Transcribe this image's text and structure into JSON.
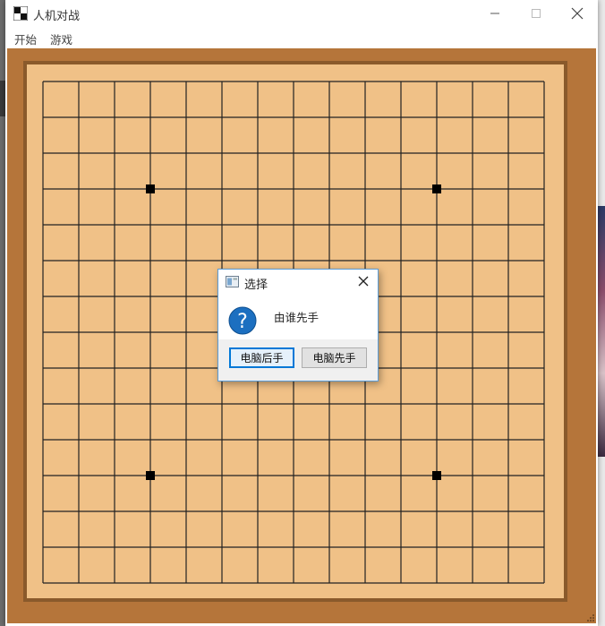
{
  "window": {
    "title": "人机对战",
    "controls": [
      "minimize-icon",
      "maximize-icon",
      "close-icon"
    ]
  },
  "menu": {
    "items": [
      {
        "label": "开始"
      },
      {
        "label": "游戏"
      }
    ]
  },
  "board": {
    "lines": 15,
    "star_points": [
      [
        3,
        3
      ],
      [
        11,
        3
      ],
      [
        3,
        11
      ],
      [
        11,
        11
      ]
    ],
    "colors": {
      "outer": "#b5753a",
      "frame": "#8a5a2b",
      "surface": "#f0c187",
      "grid": "#222222"
    }
  },
  "dialog": {
    "title": "选择",
    "icon": "question-icon",
    "message": "由谁先手",
    "buttons": {
      "computer_second": "电脑后手",
      "computer_first": "电脑先手"
    }
  }
}
